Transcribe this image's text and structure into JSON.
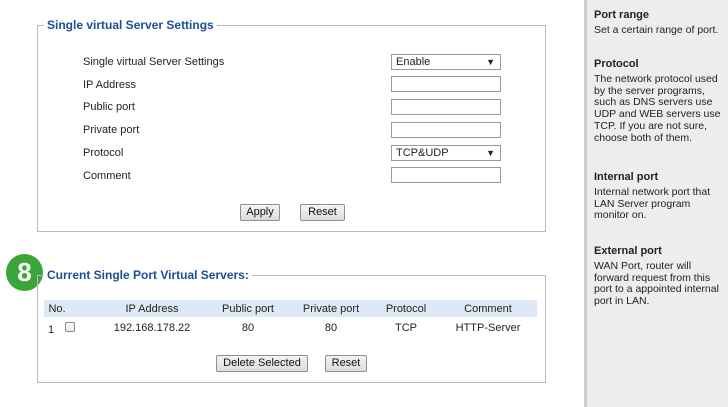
{
  "settings": {
    "legend": "Single virtual Server Settings",
    "rows": [
      {
        "label": "Single virtual Server Settings",
        "value": "Enable"
      },
      {
        "label": "IP Address",
        "value": ""
      },
      {
        "label": "Public port",
        "value": ""
      },
      {
        "label": "Private port",
        "value": ""
      },
      {
        "label": "Protocol",
        "value": "TCP&UDP"
      },
      {
        "label": "Comment",
        "value": ""
      }
    ],
    "apply_label": "Apply",
    "reset_label": "Reset"
  },
  "step_badge": "8",
  "current": {
    "legend": "Current Single Port Virtual Servers:",
    "headers": [
      "No.",
      "IP Address",
      "Public port",
      "Private port",
      "Protocol",
      "Comment"
    ],
    "rows": [
      {
        "no": "1",
        "ip": "192.168.178.22",
        "public_port": "80",
        "private_port": "80",
        "protocol": "TCP",
        "comment": "HTTP-Server"
      }
    ],
    "delete_label": "Delete Selected",
    "reset_label": "Reset"
  },
  "help": [
    {
      "title": "Port range",
      "text": "Set a certain range of port."
    },
    {
      "title": "Protocol",
      "text": "The network protocol used by the server programs, such as DNS servers use UDP and WEB servers use TCP. If you are not sure, choose both of them."
    },
    {
      "title": "Internal port",
      "text": "Internal network port that LAN Server program monitor on."
    },
    {
      "title": "External port",
      "text": "WAN Port, router will forward request from this port to a appointed internal port in LAN."
    }
  ],
  "colors": {
    "legend": "#1a4f93",
    "badge": "#3aa63a",
    "header_band": "#dde9f6",
    "sidebar": "#ededed"
  }
}
